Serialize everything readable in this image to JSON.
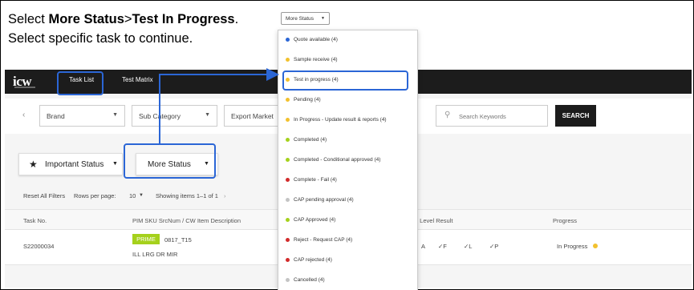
{
  "instruction": {
    "line1_prefix": "Select ",
    "line1_bold1": "More Status",
    "line1_sep": ">",
    "line1_bold2": "Test In Progress",
    "line1_suffix": ".",
    "line2": "Select specific task to continue."
  },
  "app": {
    "logo": "icw",
    "nav": {
      "task_list": "Task List",
      "test_matrix": "Test Matrix"
    },
    "filters": {
      "prev_icon": "chevron-left-icon",
      "brand": "Brand",
      "sub_category": "Sub Category",
      "export_market": "Export Market",
      "search_placeholder": "Search Keywords",
      "search_button": "SEARCH"
    },
    "status_buttons": {
      "important": "Important Status",
      "more": "More Status"
    },
    "toolbar": {
      "reset": "Reset All Filters",
      "rows_per_page_label": "Rows per page:",
      "rows_per_page_value": "10",
      "showing": "Showing items 1–1 of 1"
    },
    "table": {
      "headers": [
        "Task No.",
        "PIM SKU SrcNum / CW Item Description",
        "ting Level Result",
        "Progress"
      ],
      "row": {
        "task_no": "S22000034",
        "badge": "PRIME",
        "sku": "0817_T15",
        "description": "ILL LRG DR MIR",
        "results": [
          "A",
          "✓F",
          "✓L",
          "✓P"
        ],
        "progress": "In Progress"
      }
    }
  },
  "dropdown": {
    "trigger_label": "More Status",
    "items": [
      {
        "label": "Quote available (4)",
        "color": "#2b66d6"
      },
      {
        "label": "Sample receive (4)",
        "color": "#f2c12e"
      },
      {
        "label": "Test in progress (4)",
        "color": "#f2c12e"
      },
      {
        "label": "Pending (4)",
        "color": "#f2c12e"
      },
      {
        "label": "In Progress - Update result & reports (4)",
        "color": "#f2c12e"
      },
      {
        "label": "Completed (4)",
        "color": "#a5d11c"
      },
      {
        "label": "Completed - Conditional approved (4)",
        "color": "#a5d11c"
      },
      {
        "label": "Complete - Fail (4)",
        "color": "#d22b2b"
      },
      {
        "label": "CAP pending approval (4)",
        "color": "#c4c4c4"
      },
      {
        "label": "CAP Approved (4)",
        "color": "#a5d11c"
      },
      {
        "label": "Reject - Request CAP (4)",
        "color": "#d22b2b"
      },
      {
        "label": "CAP rejected  (4)",
        "color": "#d22b2b"
      },
      {
        "label": "Cancelled (4)",
        "color": "#c4c4c4"
      }
    ]
  },
  "colors": {
    "highlight": "#2b66d6",
    "topbar": "#1c1c1c",
    "prime_badge": "#a5d11c",
    "progress_dot": "#f2c12e"
  }
}
